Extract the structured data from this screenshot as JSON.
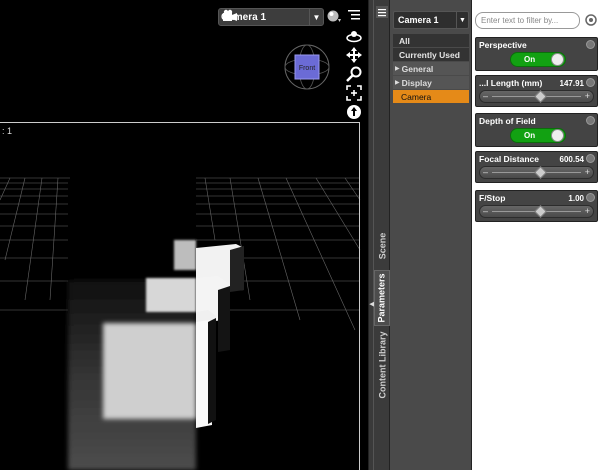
{
  "viewport": {
    "camera_select_label": "Camera 1",
    "gizmo_face_label": "Front",
    "frame_label": ": 1"
  },
  "tabs": [
    {
      "label": "Scene"
    },
    {
      "label": "Parameters"
    },
    {
      "label": "Content Library"
    }
  ],
  "categories": {
    "node_select_label": "Camera 1",
    "items": [
      {
        "label": "All"
      },
      {
        "label": "Currently Used"
      },
      {
        "label": "General"
      },
      {
        "label": "Display"
      },
      {
        "label": "Camera"
      }
    ]
  },
  "params": {
    "filter_placeholder": "Enter text to filter by...",
    "perspective": {
      "label": "Perspective",
      "state": "On"
    },
    "focal_length": {
      "label": "...l Length (mm)",
      "value": "147.91",
      "fraction": 0.55
    },
    "dof": {
      "label": "Depth of Field",
      "state": "On"
    },
    "focal_distance": {
      "label": "Focal Distance",
      "value": "600.54",
      "fraction": 0.55
    },
    "fstop": {
      "label": "F/Stop",
      "value": "1.00",
      "fraction": 0.55
    }
  },
  "colors": {
    "selected_category": "#e58a18",
    "toggle_on": "#12a112",
    "gizmo": "#6b6bd6"
  }
}
